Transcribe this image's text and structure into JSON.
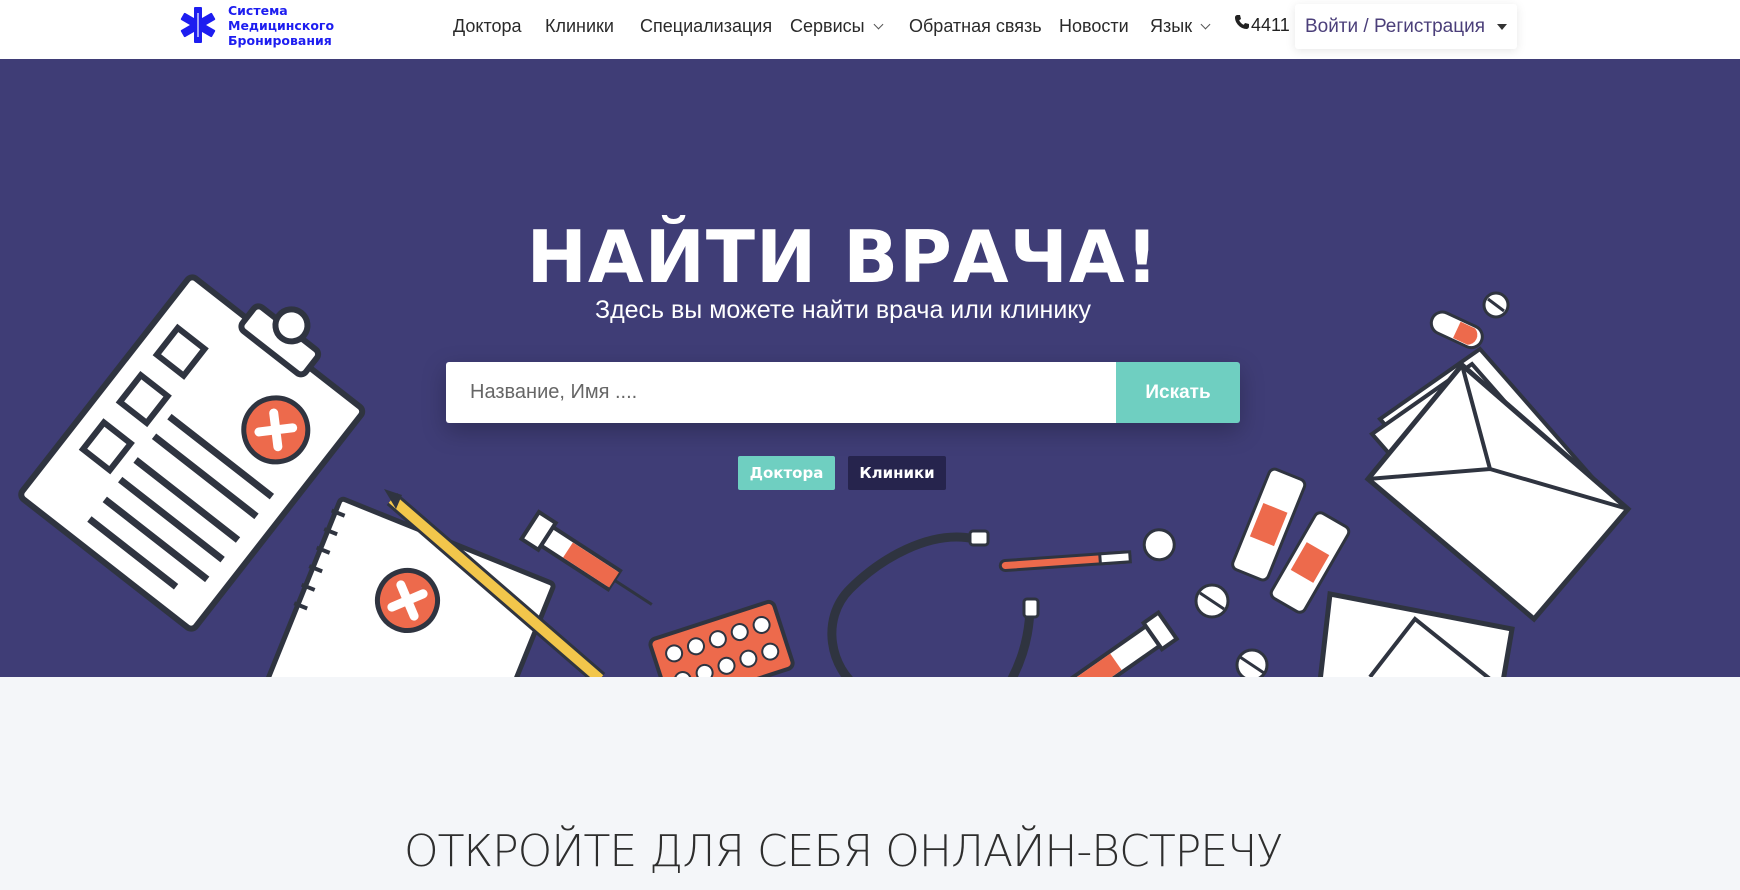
{
  "brand": {
    "line1": "Система",
    "line2": "Медицинского",
    "line3": "Бронирования",
    "color": "#1d1df0",
    "icon": "star-of-life-icon"
  },
  "nav": {
    "doctors": "Доктора",
    "clinics": "Клиники",
    "specialization": "Специализация",
    "services": "Сервисы",
    "feedback": "Обратная связь",
    "news": "Новости",
    "language": "Язык",
    "phone": "4411",
    "login": "Войти / Регистрация"
  },
  "hero": {
    "title": "НАЙТИ ВРАЧА!",
    "subtitle": "Здесь вы можете найти врача или клинику",
    "search_placeholder": "Название, Имя ....",
    "search_button": "Искать",
    "tab_doctors": "Доктора",
    "tab_clinics": "Клиники",
    "background_color": "#3f3d76",
    "accent_color": "#6fcfc1"
  },
  "section": {
    "title": "ОТКРОЙТЕ ДЛЯ СЕБЯ ОНЛАЙН-ВСТРЕЧУ"
  }
}
